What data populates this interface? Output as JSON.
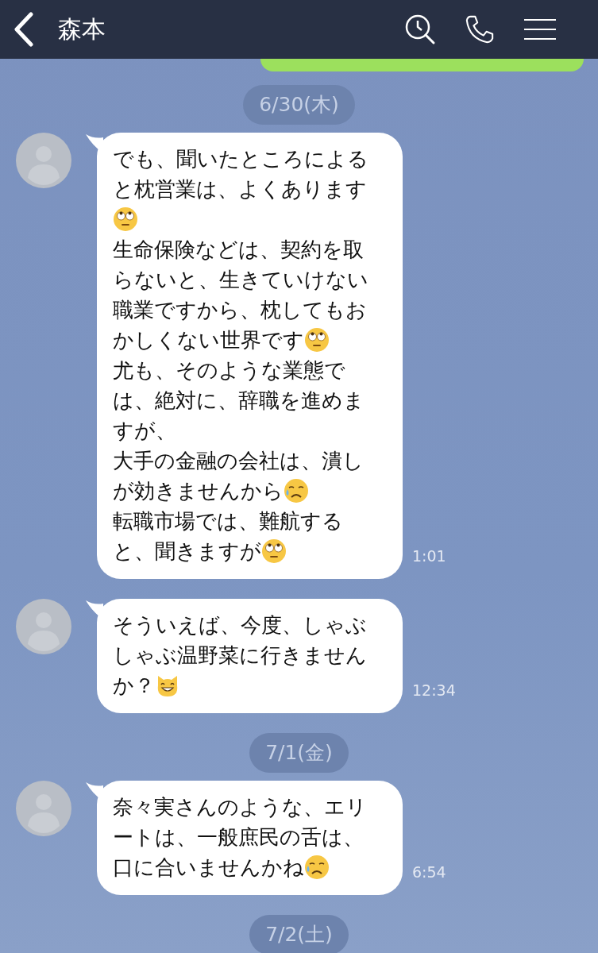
{
  "header": {
    "title": "森本"
  },
  "chat": [
    {
      "kind": "date",
      "text": "6/30(木)"
    },
    {
      "kind": "message",
      "time": "1:01",
      "lines": [
        [
          {
            "kind": "text",
            "text": "でも、聞いたところによる"
          }
        ],
        [
          {
            "kind": "text",
            "text": "と枕営業は、よくあります"
          }
        ],
        [
          {
            "kind": "eye-roll"
          }
        ],
        [
          {
            "kind": "text",
            "text": "生命保険などは、契約を取"
          }
        ],
        [
          {
            "kind": "text",
            "text": "らないと、生きていけない"
          }
        ],
        [
          {
            "kind": "text",
            "text": "職業ですから、枕してもお"
          }
        ],
        [
          {
            "kind": "text",
            "text": "かしくない世界です"
          },
          {
            "kind": "eye-roll"
          }
        ],
        [
          {
            "kind": "text",
            "text": "尤も、そのような業態で"
          }
        ],
        [
          {
            "kind": "text",
            "text": "は、絶対に、辞職を進めま"
          }
        ],
        [
          {
            "kind": "text",
            "text": "すが、"
          }
        ],
        [
          {
            "kind": "text",
            "text": "大手の金融の会社は、潰し"
          }
        ],
        [
          {
            "kind": "text",
            "text": "が効きませんから"
          },
          {
            "kind": "sad"
          }
        ],
        [
          {
            "kind": "text",
            "text": "転職市場では、難航する"
          }
        ],
        [
          {
            "kind": "text",
            "text": "と、聞きますが"
          },
          {
            "kind": "eye-roll"
          }
        ]
      ]
    },
    {
      "kind": "message",
      "time": "12:34",
      "lines": [
        [
          {
            "kind": "text",
            "text": "そういえば、今度、しゃぶ"
          }
        ],
        [
          {
            "kind": "text",
            "text": "しゃぶ温野菜に行きません"
          }
        ],
        [
          {
            "kind": "text",
            "text": "か？"
          },
          {
            "kind": "cat"
          }
        ]
      ]
    },
    {
      "kind": "date",
      "text": "7/1(金)"
    },
    {
      "kind": "message",
      "time": "6:54",
      "lines": [
        [
          {
            "kind": "text",
            "text": "奈々実さんのような、エリ"
          }
        ],
        [
          {
            "kind": "text",
            "text": "ートは、一般庶民の舌は、"
          }
        ],
        [
          {
            "kind": "text",
            "text": "口に合いませんかね"
          },
          {
            "kind": "sad"
          }
        ]
      ]
    },
    {
      "kind": "date",
      "text": "7/2(土)"
    }
  ]
}
